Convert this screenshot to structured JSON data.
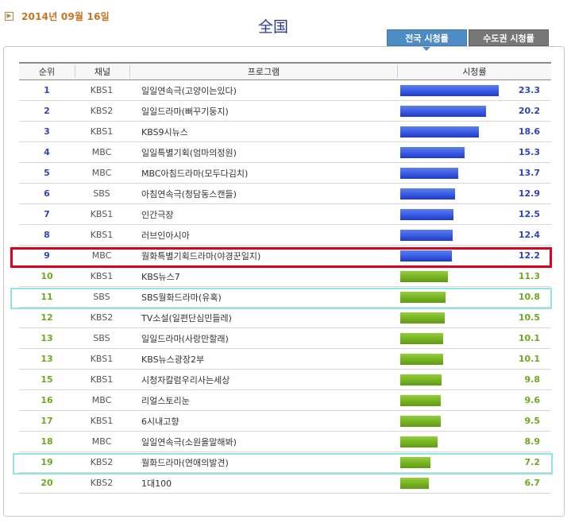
{
  "header": {
    "date": "2014년 09월 16일",
    "date_icon": "arrow-right-icon",
    "title": "全国"
  },
  "tabs": [
    {
      "label": "전국 시청률",
      "active": true
    },
    {
      "label": "수도권 시청률",
      "active": false
    }
  ],
  "table": {
    "headers": [
      "순위",
      "채널",
      "프로그램",
      "시청률"
    ],
    "rows": [
      {
        "rank": "1",
        "channel": "KBS1",
        "program": "일일연속극(고양이는있다)",
        "rating": "23.3"
      },
      {
        "rank": "2",
        "channel": "KBS2",
        "program": "일일드라마(뻐꾸기둥지)",
        "rating": "20.2"
      },
      {
        "rank": "3",
        "channel": "KBS1",
        "program": "KBS9시뉴스",
        "rating": "18.6"
      },
      {
        "rank": "4",
        "channel": "MBC",
        "program": "일일특별기획(엄마의정원)",
        "rating": "15.3"
      },
      {
        "rank": "5",
        "channel": "MBC",
        "program": "MBC아침드라마(모두다김치)",
        "rating": "13.7"
      },
      {
        "rank": "6",
        "channel": "SBS",
        "program": "아침연속극(청담동스캔들)",
        "rating": "12.9"
      },
      {
        "rank": "7",
        "channel": "KBS1",
        "program": "인간극장",
        "rating": "12.5"
      },
      {
        "rank": "8",
        "channel": "KBS1",
        "program": "러브인아시아",
        "rating": "12.4"
      },
      {
        "rank": "9",
        "channel": "MBC",
        "program": "월화특별기획드라마(야경꾼일지)",
        "rating": "12.2"
      },
      {
        "rank": "10",
        "channel": "KBS1",
        "program": "KBS뉴스7",
        "rating": "11.3"
      },
      {
        "rank": "11",
        "channel": "SBS",
        "program": "SBS월화드라마(유혹)",
        "rating": "10.8"
      },
      {
        "rank": "12",
        "channel": "KBS2",
        "program": "TV소설(일편단심민들레)",
        "rating": "10.5"
      },
      {
        "rank": "13",
        "channel": "SBS",
        "program": "일일드라마(사랑만할래)",
        "rating": "10.1"
      },
      {
        "rank": "13",
        "channel": "KBS1",
        "program": "KBS뉴스광장2부",
        "rating": "10.1"
      },
      {
        "rank": "15",
        "channel": "KBS1",
        "program": "시청자칼럼우리사는세상",
        "rating": "9.8"
      },
      {
        "rank": "16",
        "channel": "MBC",
        "program": "리얼스토리눈",
        "rating": "9.6"
      },
      {
        "rank": "17",
        "channel": "KBS1",
        "program": "6시내고향",
        "rating": "9.5"
      },
      {
        "rank": "18",
        "channel": "MBC",
        "program": "일일연속극(소원을말해봐)",
        "rating": "8.9"
      },
      {
        "rank": "19",
        "channel": "KBS2",
        "program": "월화드라마(연애의발견)",
        "rating": "7.2"
      },
      {
        "rank": "20",
        "channel": "KBS2",
        "program": "1대100",
        "rating": "6.7"
      }
    ]
  },
  "colors": {
    "blue_bar": "#2c44c0",
    "green_bar": "#6aaa1e",
    "highlight_red": "#e0001b",
    "highlight_cyan": "#8ee6e6"
  }
}
